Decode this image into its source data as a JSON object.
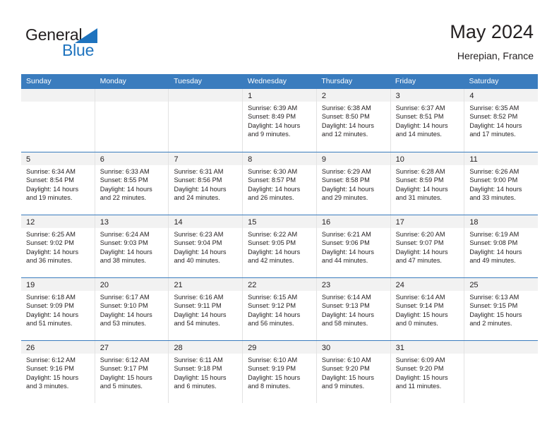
{
  "brand": {
    "name_part1": "General",
    "name_part2": "Blue",
    "triangle_color": "#1e73be",
    "text_color": "#231f20"
  },
  "header": {
    "title": "May 2024",
    "subtitle": "Herepian, France"
  },
  "theme": {
    "header_blue": "#3a7cbe",
    "daynum_band": "#f2f2f2",
    "cell_divider": "#e3e3e3",
    "text": "#231f20"
  },
  "weekdays": [
    "Sunday",
    "Monday",
    "Tuesday",
    "Wednesday",
    "Thursday",
    "Friday",
    "Saturday"
  ],
  "weeks": [
    [
      {
        "day": "",
        "lines": []
      },
      {
        "day": "",
        "lines": []
      },
      {
        "day": "",
        "lines": []
      },
      {
        "day": "1",
        "lines": [
          "Sunrise: 6:39 AM",
          "Sunset: 8:49 PM",
          "Daylight: 14 hours and 9 minutes."
        ]
      },
      {
        "day": "2",
        "lines": [
          "Sunrise: 6:38 AM",
          "Sunset: 8:50 PM",
          "Daylight: 14 hours and 12 minutes."
        ]
      },
      {
        "day": "3",
        "lines": [
          "Sunrise: 6:37 AM",
          "Sunset: 8:51 PM",
          "Daylight: 14 hours and 14 minutes."
        ]
      },
      {
        "day": "4",
        "lines": [
          "Sunrise: 6:35 AM",
          "Sunset: 8:52 PM",
          "Daylight: 14 hours and 17 minutes."
        ]
      }
    ],
    [
      {
        "day": "5",
        "lines": [
          "Sunrise: 6:34 AM",
          "Sunset: 8:54 PM",
          "Daylight: 14 hours and 19 minutes."
        ]
      },
      {
        "day": "6",
        "lines": [
          "Sunrise: 6:33 AM",
          "Sunset: 8:55 PM",
          "Daylight: 14 hours and 22 minutes."
        ]
      },
      {
        "day": "7",
        "lines": [
          "Sunrise: 6:31 AM",
          "Sunset: 8:56 PM",
          "Daylight: 14 hours and 24 minutes."
        ]
      },
      {
        "day": "8",
        "lines": [
          "Sunrise: 6:30 AM",
          "Sunset: 8:57 PM",
          "Daylight: 14 hours and 26 minutes."
        ]
      },
      {
        "day": "9",
        "lines": [
          "Sunrise: 6:29 AM",
          "Sunset: 8:58 PM",
          "Daylight: 14 hours and 29 minutes."
        ]
      },
      {
        "day": "10",
        "lines": [
          "Sunrise: 6:28 AM",
          "Sunset: 8:59 PM",
          "Daylight: 14 hours and 31 minutes."
        ]
      },
      {
        "day": "11",
        "lines": [
          "Sunrise: 6:26 AM",
          "Sunset: 9:00 PM",
          "Daylight: 14 hours and 33 minutes."
        ]
      }
    ],
    [
      {
        "day": "12",
        "lines": [
          "Sunrise: 6:25 AM",
          "Sunset: 9:02 PM",
          "Daylight: 14 hours and 36 minutes."
        ]
      },
      {
        "day": "13",
        "lines": [
          "Sunrise: 6:24 AM",
          "Sunset: 9:03 PM",
          "Daylight: 14 hours and 38 minutes."
        ]
      },
      {
        "day": "14",
        "lines": [
          "Sunrise: 6:23 AM",
          "Sunset: 9:04 PM",
          "Daylight: 14 hours and 40 minutes."
        ]
      },
      {
        "day": "15",
        "lines": [
          "Sunrise: 6:22 AM",
          "Sunset: 9:05 PM",
          "Daylight: 14 hours and 42 minutes."
        ]
      },
      {
        "day": "16",
        "lines": [
          "Sunrise: 6:21 AM",
          "Sunset: 9:06 PM",
          "Daylight: 14 hours and 44 minutes."
        ]
      },
      {
        "day": "17",
        "lines": [
          "Sunrise: 6:20 AM",
          "Sunset: 9:07 PM",
          "Daylight: 14 hours and 47 minutes."
        ]
      },
      {
        "day": "18",
        "lines": [
          "Sunrise: 6:19 AM",
          "Sunset: 9:08 PM",
          "Daylight: 14 hours and 49 minutes."
        ]
      }
    ],
    [
      {
        "day": "19",
        "lines": [
          "Sunrise: 6:18 AM",
          "Sunset: 9:09 PM",
          "Daylight: 14 hours and 51 minutes."
        ]
      },
      {
        "day": "20",
        "lines": [
          "Sunrise: 6:17 AM",
          "Sunset: 9:10 PM",
          "Daylight: 14 hours and 53 minutes."
        ]
      },
      {
        "day": "21",
        "lines": [
          "Sunrise: 6:16 AM",
          "Sunset: 9:11 PM",
          "Daylight: 14 hours and 54 minutes."
        ]
      },
      {
        "day": "22",
        "lines": [
          "Sunrise: 6:15 AM",
          "Sunset: 9:12 PM",
          "Daylight: 14 hours and 56 minutes."
        ]
      },
      {
        "day": "23",
        "lines": [
          "Sunrise: 6:14 AM",
          "Sunset: 9:13 PM",
          "Daylight: 14 hours and 58 minutes."
        ]
      },
      {
        "day": "24",
        "lines": [
          "Sunrise: 6:14 AM",
          "Sunset: 9:14 PM",
          "Daylight: 15 hours and 0 minutes."
        ]
      },
      {
        "day": "25",
        "lines": [
          "Sunrise: 6:13 AM",
          "Sunset: 9:15 PM",
          "Daylight: 15 hours and 2 minutes."
        ]
      }
    ],
    [
      {
        "day": "26",
        "lines": [
          "Sunrise: 6:12 AM",
          "Sunset: 9:16 PM",
          "Daylight: 15 hours and 3 minutes."
        ]
      },
      {
        "day": "27",
        "lines": [
          "Sunrise: 6:12 AM",
          "Sunset: 9:17 PM",
          "Daylight: 15 hours and 5 minutes."
        ]
      },
      {
        "day": "28",
        "lines": [
          "Sunrise: 6:11 AM",
          "Sunset: 9:18 PM",
          "Daylight: 15 hours and 6 minutes."
        ]
      },
      {
        "day": "29",
        "lines": [
          "Sunrise: 6:10 AM",
          "Sunset: 9:19 PM",
          "Daylight: 15 hours and 8 minutes."
        ]
      },
      {
        "day": "30",
        "lines": [
          "Sunrise: 6:10 AM",
          "Sunset: 9:20 PM",
          "Daylight: 15 hours and 9 minutes."
        ]
      },
      {
        "day": "31",
        "lines": [
          "Sunrise: 6:09 AM",
          "Sunset: 9:20 PM",
          "Daylight: 15 hours and 11 minutes."
        ]
      },
      {
        "day": "",
        "lines": []
      }
    ]
  ]
}
